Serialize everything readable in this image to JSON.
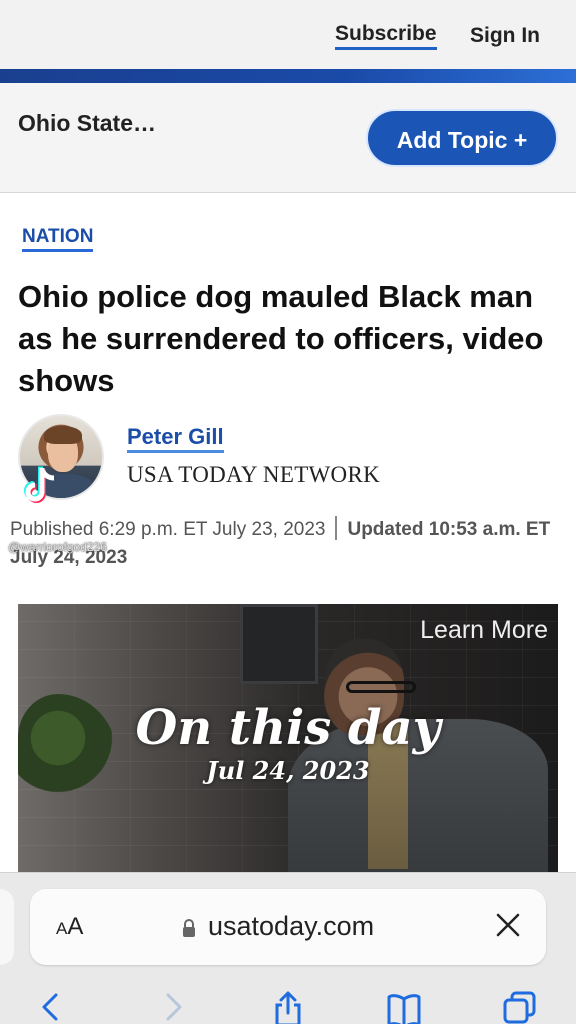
{
  "header": {
    "subscribe_label": "Subscribe",
    "signin_label": "Sign In"
  },
  "topic_bar": {
    "topic_label": "Ohio State…",
    "add_topic_label": "Add Topic +"
  },
  "article": {
    "section_label": "NATION",
    "headline": "Ohio police dog mauled Black man as he surrendered to officers, video shows",
    "author_name": "Peter Gill",
    "author_org": "USA TODAY NETWORK",
    "published_text": "Published 6:29 p.m. ET July 23, 2023",
    "updated_text": "Updated 10:53 a.m. ET July 24, 2023"
  },
  "video": {
    "learn_more_label": "Learn More"
  },
  "overlay": {
    "title": "On this day",
    "date": "Jul 24, 2023",
    "tiktok_username": "@warriorofgod226"
  },
  "safari": {
    "text_size_label_small": "A",
    "text_size_label_large": "A",
    "url": "usatoday.com"
  },
  "colors": {
    "brand_blue": "#1b55b5",
    "link_blue": "#1b4ea8"
  }
}
